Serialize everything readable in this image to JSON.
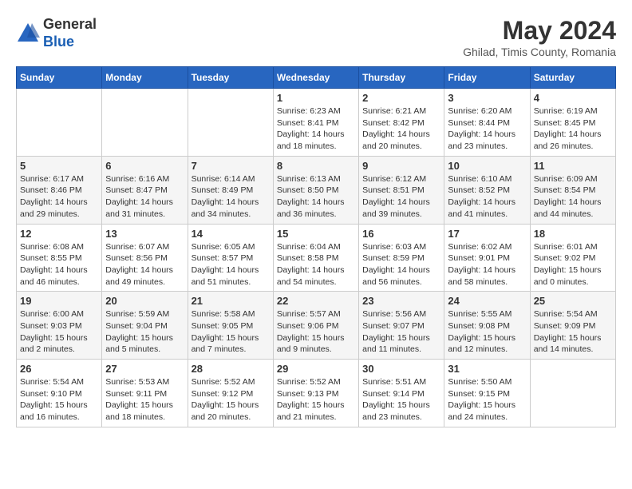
{
  "header": {
    "logo_line1": "General",
    "logo_line2": "Blue",
    "month_title": "May 2024",
    "subtitle": "Ghilad, Timis County, Romania"
  },
  "days_of_week": [
    "Sunday",
    "Monday",
    "Tuesday",
    "Wednesday",
    "Thursday",
    "Friday",
    "Saturday"
  ],
  "weeks": [
    [
      {
        "day": "",
        "detail": ""
      },
      {
        "day": "",
        "detail": ""
      },
      {
        "day": "",
        "detail": ""
      },
      {
        "day": "1",
        "detail": "Sunrise: 6:23 AM\nSunset: 8:41 PM\nDaylight: 14 hours\nand 18 minutes."
      },
      {
        "day": "2",
        "detail": "Sunrise: 6:21 AM\nSunset: 8:42 PM\nDaylight: 14 hours\nand 20 minutes."
      },
      {
        "day": "3",
        "detail": "Sunrise: 6:20 AM\nSunset: 8:44 PM\nDaylight: 14 hours\nand 23 minutes."
      },
      {
        "day": "4",
        "detail": "Sunrise: 6:19 AM\nSunset: 8:45 PM\nDaylight: 14 hours\nand 26 minutes."
      }
    ],
    [
      {
        "day": "5",
        "detail": "Sunrise: 6:17 AM\nSunset: 8:46 PM\nDaylight: 14 hours\nand 29 minutes."
      },
      {
        "day": "6",
        "detail": "Sunrise: 6:16 AM\nSunset: 8:47 PM\nDaylight: 14 hours\nand 31 minutes."
      },
      {
        "day": "7",
        "detail": "Sunrise: 6:14 AM\nSunset: 8:49 PM\nDaylight: 14 hours\nand 34 minutes."
      },
      {
        "day": "8",
        "detail": "Sunrise: 6:13 AM\nSunset: 8:50 PM\nDaylight: 14 hours\nand 36 minutes."
      },
      {
        "day": "9",
        "detail": "Sunrise: 6:12 AM\nSunset: 8:51 PM\nDaylight: 14 hours\nand 39 minutes."
      },
      {
        "day": "10",
        "detail": "Sunrise: 6:10 AM\nSunset: 8:52 PM\nDaylight: 14 hours\nand 41 minutes."
      },
      {
        "day": "11",
        "detail": "Sunrise: 6:09 AM\nSunset: 8:54 PM\nDaylight: 14 hours\nand 44 minutes."
      }
    ],
    [
      {
        "day": "12",
        "detail": "Sunrise: 6:08 AM\nSunset: 8:55 PM\nDaylight: 14 hours\nand 46 minutes."
      },
      {
        "day": "13",
        "detail": "Sunrise: 6:07 AM\nSunset: 8:56 PM\nDaylight: 14 hours\nand 49 minutes."
      },
      {
        "day": "14",
        "detail": "Sunrise: 6:05 AM\nSunset: 8:57 PM\nDaylight: 14 hours\nand 51 minutes."
      },
      {
        "day": "15",
        "detail": "Sunrise: 6:04 AM\nSunset: 8:58 PM\nDaylight: 14 hours\nand 54 minutes."
      },
      {
        "day": "16",
        "detail": "Sunrise: 6:03 AM\nSunset: 8:59 PM\nDaylight: 14 hours\nand 56 minutes."
      },
      {
        "day": "17",
        "detail": "Sunrise: 6:02 AM\nSunset: 9:01 PM\nDaylight: 14 hours\nand 58 minutes."
      },
      {
        "day": "18",
        "detail": "Sunrise: 6:01 AM\nSunset: 9:02 PM\nDaylight: 15 hours\nand 0 minutes."
      }
    ],
    [
      {
        "day": "19",
        "detail": "Sunrise: 6:00 AM\nSunset: 9:03 PM\nDaylight: 15 hours\nand 2 minutes."
      },
      {
        "day": "20",
        "detail": "Sunrise: 5:59 AM\nSunset: 9:04 PM\nDaylight: 15 hours\nand 5 minutes."
      },
      {
        "day": "21",
        "detail": "Sunrise: 5:58 AM\nSunset: 9:05 PM\nDaylight: 15 hours\nand 7 minutes."
      },
      {
        "day": "22",
        "detail": "Sunrise: 5:57 AM\nSunset: 9:06 PM\nDaylight: 15 hours\nand 9 minutes."
      },
      {
        "day": "23",
        "detail": "Sunrise: 5:56 AM\nSunset: 9:07 PM\nDaylight: 15 hours\nand 11 minutes."
      },
      {
        "day": "24",
        "detail": "Sunrise: 5:55 AM\nSunset: 9:08 PM\nDaylight: 15 hours\nand 12 minutes."
      },
      {
        "day": "25",
        "detail": "Sunrise: 5:54 AM\nSunset: 9:09 PM\nDaylight: 15 hours\nand 14 minutes."
      }
    ],
    [
      {
        "day": "26",
        "detail": "Sunrise: 5:54 AM\nSunset: 9:10 PM\nDaylight: 15 hours\nand 16 minutes."
      },
      {
        "day": "27",
        "detail": "Sunrise: 5:53 AM\nSunset: 9:11 PM\nDaylight: 15 hours\nand 18 minutes."
      },
      {
        "day": "28",
        "detail": "Sunrise: 5:52 AM\nSunset: 9:12 PM\nDaylight: 15 hours\nand 20 minutes."
      },
      {
        "day": "29",
        "detail": "Sunrise: 5:52 AM\nSunset: 9:13 PM\nDaylight: 15 hours\nand 21 minutes."
      },
      {
        "day": "30",
        "detail": "Sunrise: 5:51 AM\nSunset: 9:14 PM\nDaylight: 15 hours\nand 23 minutes."
      },
      {
        "day": "31",
        "detail": "Sunrise: 5:50 AM\nSunset: 9:15 PM\nDaylight: 15 hours\nand 24 minutes."
      },
      {
        "day": "",
        "detail": ""
      }
    ]
  ]
}
